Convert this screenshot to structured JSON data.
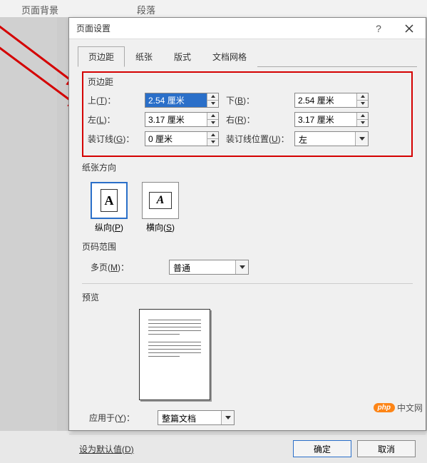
{
  "ribbon": {
    "page_bg": "页面背景",
    "paragraph": "段落"
  },
  "dialog": {
    "title": "页面设置",
    "tabs": {
      "margins": "页边距",
      "paper": "纸张",
      "layout": "版式",
      "grid": "文档网格"
    }
  },
  "margins": {
    "section_label": "页边距",
    "top_label": "上(T)：",
    "top_value": "2.54 厘米",
    "bottom_label": "下(B)：",
    "bottom_value": "2.54 厘米",
    "left_label": "左(L)：",
    "left_value": "3.17 厘米",
    "right_label": "右(R)：",
    "right_value": "3.17 厘米",
    "gutter_label": "装订线(G)：",
    "gutter_value": "0 厘米",
    "gutter_pos_label": "装订线位置(U)：",
    "gutter_pos_value": "左"
  },
  "orientation": {
    "section_label": "纸张方向",
    "portrait_label": "纵向(P)",
    "landscape_label": "横向(S)"
  },
  "pages_range": {
    "section_label": "页码范围",
    "multi_label": "多页(M)：",
    "multi_value": "普通"
  },
  "preview": {
    "section_label": "预览"
  },
  "apply_to": {
    "label": "应用于(Y)：",
    "value": "整篇文档"
  },
  "footer": {
    "default_btn": "设为默认值(D)",
    "ok_btn": "确定",
    "cancel_btn": "取消"
  },
  "watermark": {
    "badge": "php",
    "text": "中文网"
  }
}
